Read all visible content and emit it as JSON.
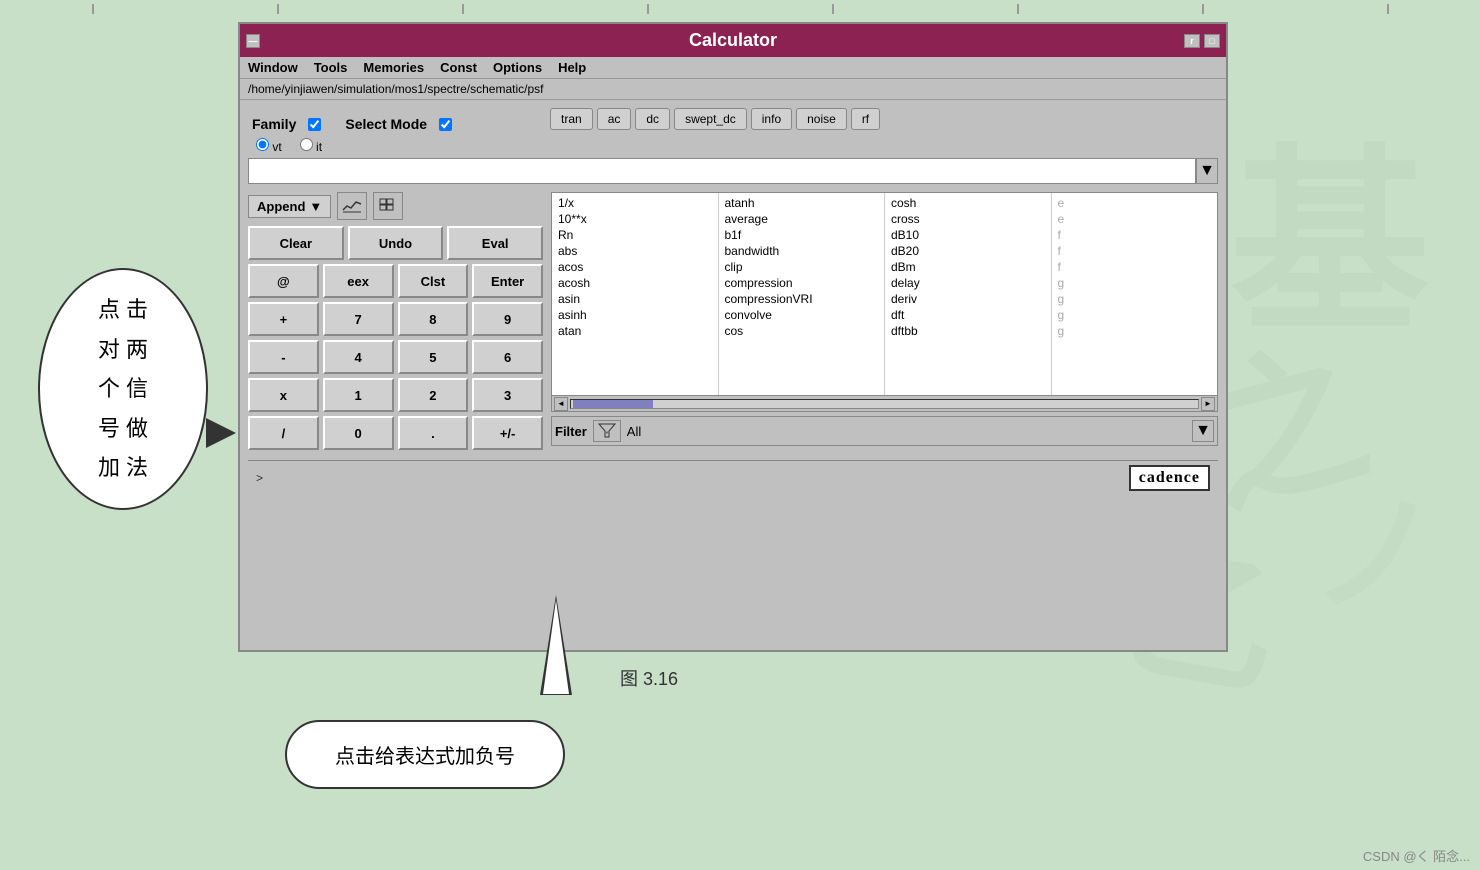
{
  "window": {
    "title": "Calculator",
    "path": "/home/yinjiawen/simulation/mos1/spectre/schematic/psf"
  },
  "menu": {
    "items": [
      "Window",
      "Tools",
      "Memories",
      "Const",
      "Options",
      "Help"
    ]
  },
  "tabs": {
    "items": [
      "tran",
      "ac",
      "dc",
      "swept_dc",
      "info",
      "noise",
      "rf"
    ]
  },
  "family": {
    "label": "Family",
    "checkbox_label": "Select Mode",
    "radio_vt": "vt",
    "radio_it": "it"
  },
  "append": {
    "label": "Append",
    "icon_chart": "📈",
    "icon_grid": "⊞"
  },
  "buttons": {
    "clear": "Clear",
    "undo": "Undo",
    "eval": "Eval",
    "at": "@",
    "eex": "eex",
    "clst": "Clst",
    "enter": "Enter",
    "plus": "+",
    "n7": "7",
    "n8": "8",
    "n9": "9",
    "minus": "-",
    "n4": "4",
    "n5": "5",
    "n6": "6",
    "mult": "x",
    "n1": "1",
    "n2": "2",
    "n3": "3",
    "div": "/",
    "n0": "0",
    "dot": ".",
    "plusminus": "+/-"
  },
  "functions": {
    "col1": [
      "1/x",
      "10**x",
      "Rn",
      "abs",
      "acos",
      "acosh",
      "asin",
      "asinh",
      "atan"
    ],
    "col2": [
      "atanh",
      "average",
      "b1f",
      "bandwidth",
      "clip",
      "compression",
      "compressionVRI",
      "convolve",
      "cos"
    ],
    "col3": [
      "cosh",
      "cross",
      "dB10",
      "dB20",
      "dBm",
      "delay",
      "deriv",
      "dft",
      "dftbb"
    ]
  },
  "filter": {
    "label": "Filter",
    "value": "All"
  },
  "annotations": {
    "left_text": "点 击\n对 两\n个 信\n号 做\n加 法",
    "bottom_text": "点击给表达式加负号",
    "figure_caption": "图 3.16"
  },
  "cadence_logo": "cadence",
  "csdn": "CSDN @く 陌念..."
}
